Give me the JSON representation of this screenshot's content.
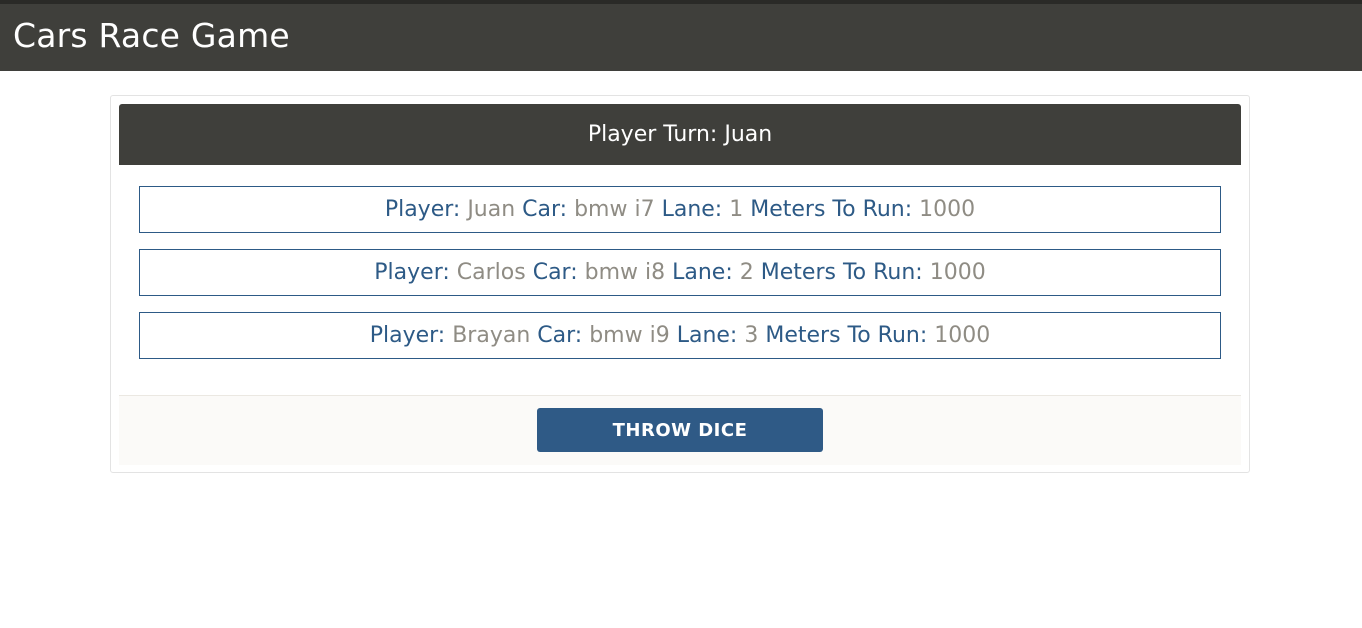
{
  "app": {
    "title": "Cars Race Game"
  },
  "game": {
    "turn_label": "Player Turn:",
    "current_player": "Juan",
    "labels": {
      "player": "Player:",
      "car": "Car:",
      "lane": "Lane:",
      "meters": "Meters To Run:"
    },
    "players": [
      {
        "name": "Juan",
        "car": "bmw i7",
        "lane": "1",
        "meters": "1000"
      },
      {
        "name": "Carlos",
        "car": "bmw i8",
        "lane": "2",
        "meters": "1000"
      },
      {
        "name": "Brayan",
        "car": "bmw i9",
        "lane": "3",
        "meters": "1000"
      }
    ],
    "throw_button": "THROW DICE"
  },
  "colors": {
    "navbar": "#3f3f3b",
    "label_blue": "#2d5a86",
    "value_gray": "#8f8c84",
    "button": "#2f5a86"
  }
}
